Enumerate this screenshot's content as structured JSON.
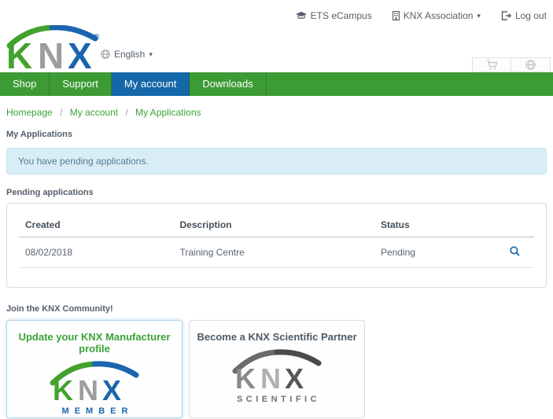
{
  "colors": {
    "logo-green": "#43a22e",
    "logo-gray": "#9d9d9c",
    "logo-blue": "#1b65ae",
    "nav-green": "#3c9b35",
    "nav-blue": "#1467a8",
    "link-green": "#3aa335",
    "text-dark": "#55606b",
    "alert-bg": "#d9edf7",
    "alert-border": "#c2e3f0",
    "alert-text": "#547c90",
    "sci-dark": "#575756",
    "sci-mid": "#8a8a89",
    "sci-light": "#b1b1b0",
    "card-member-border": "#aed6e6"
  },
  "header": {
    "links": [
      {
        "label": "ETS eCampus",
        "icon": "graduation-cap-icon"
      },
      {
        "label": "KNX Association",
        "icon": "building-icon",
        "caret": "▾"
      },
      {
        "label": "Log out",
        "icon": "logout-icon"
      }
    ],
    "language": {
      "label": "English",
      "icon": "globe-icon",
      "caret": "▾"
    },
    "logo": {
      "k": "K",
      "n": "N",
      "x": "X",
      "registered": "®"
    },
    "mini_tabs": [
      {
        "icon": "cart-icon"
      },
      {
        "icon": "globe-icon"
      }
    ]
  },
  "nav": {
    "items": [
      {
        "label": "Shop",
        "active": false
      },
      {
        "label": "Support",
        "active": false
      },
      {
        "label": "My account",
        "active": true
      },
      {
        "label": "Downloads",
        "active": false
      }
    ]
  },
  "breadcrumb": {
    "separator": "/",
    "items": [
      "Homepage",
      "My account",
      "My Applications"
    ]
  },
  "page": {
    "title": "My Applications",
    "alert": "You have pending applications.",
    "pending_label": "Pending applications",
    "community_label": "Join the KNX Community!"
  },
  "table": {
    "columns": [
      "Created",
      "Description",
      "Status"
    ],
    "rows": [
      {
        "created": "08/02/2018",
        "description": "Training Centre",
        "status": "Pending",
        "action_icon": "magnifier-icon"
      }
    ]
  },
  "cards": [
    {
      "title": "Update your KNX Manufacturer profile",
      "logo_label": "MEMBER"
    },
    {
      "title": "Become a KNX Scientific Partner",
      "logo_label": "SCIENTIFIC"
    }
  ]
}
